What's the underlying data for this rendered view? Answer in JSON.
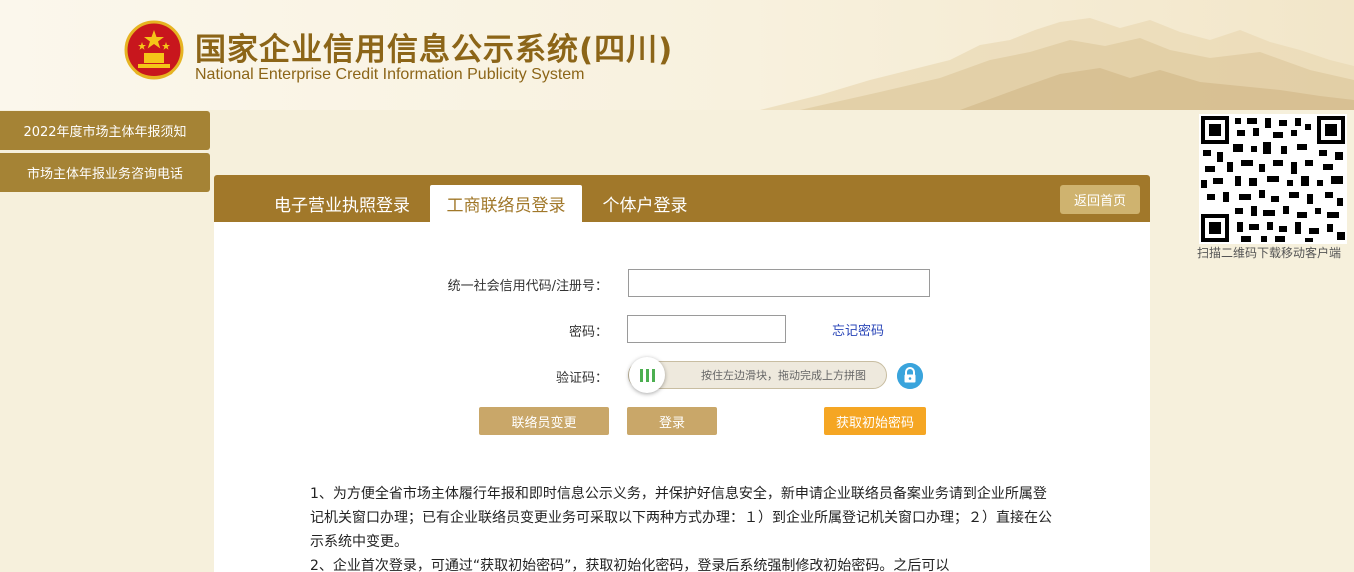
{
  "header": {
    "title": "国家企业信用信息公示系统(四川)",
    "subtitle": "National Enterprise Credit Information Publicity System"
  },
  "sidebar": {
    "items": [
      {
        "label": "2022年度市场主体年报须知"
      },
      {
        "label": "市场主体年报业务咨询电话"
      }
    ]
  },
  "qr": {
    "caption": "扫描二维码下载移动客户端"
  },
  "tabs": [
    {
      "label": "电子营业执照登录",
      "active": false
    },
    {
      "label": "工商联络员登录",
      "active": true
    },
    {
      "label": "个体户登录",
      "active": false
    }
  ],
  "home_button": "返回首页",
  "form": {
    "credit_code_label": "统一社会信用代码/注册号：",
    "credit_code_value": "",
    "password_label": "密码：",
    "password_value": "",
    "forgot_password": "忘记密码",
    "captcha_label": "验证码：",
    "slider_hint": "按住左边滑块，拖动完成上方拼图"
  },
  "buttons": {
    "change_contact": "联络员变更",
    "login": "登录",
    "get_initial_password": "获取初始密码"
  },
  "notice": {
    "paragraphs": [
      "1、为方便全省市场主体履行年报和即时信息公示义务，并保护好信息安全，新申请企业联络员备案业务请到企业所属登记机关窗口办理；已有企业联络员变更业务可采取以下两种方式办理：１）到企业所属登记机关窗口办理；２）直接在公示系统中变更。",
      "2、企业首次登录，可通过“获取初始密码”，获取初始化密码，登录后系统强制修改初始密码。之后可以"
    ]
  },
  "colors": {
    "brand": "#a1782a",
    "sidebar": "#a58335",
    "accent_orange": "#f5a623",
    "button_tan": "#c9a769"
  }
}
